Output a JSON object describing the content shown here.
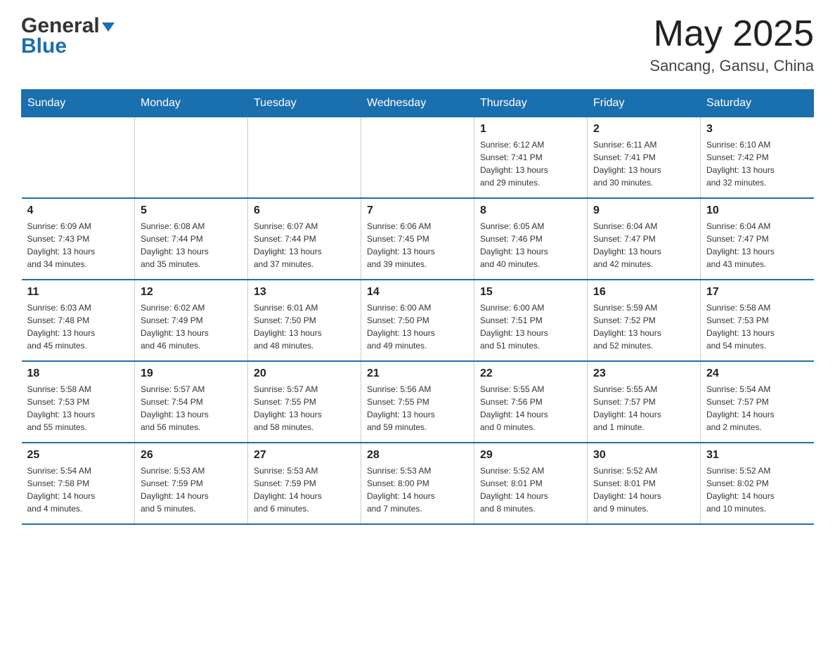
{
  "header": {
    "logo_general": "General",
    "logo_blue": "Blue",
    "month_year": "May 2025",
    "location": "Sancang, Gansu, China"
  },
  "days_of_week": [
    "Sunday",
    "Monday",
    "Tuesday",
    "Wednesday",
    "Thursday",
    "Friday",
    "Saturday"
  ],
  "weeks": [
    [
      {
        "day": "",
        "info": ""
      },
      {
        "day": "",
        "info": ""
      },
      {
        "day": "",
        "info": ""
      },
      {
        "day": "",
        "info": ""
      },
      {
        "day": "1",
        "info": "Sunrise: 6:12 AM\nSunset: 7:41 PM\nDaylight: 13 hours\nand 29 minutes."
      },
      {
        "day": "2",
        "info": "Sunrise: 6:11 AM\nSunset: 7:41 PM\nDaylight: 13 hours\nand 30 minutes."
      },
      {
        "day": "3",
        "info": "Sunrise: 6:10 AM\nSunset: 7:42 PM\nDaylight: 13 hours\nand 32 minutes."
      }
    ],
    [
      {
        "day": "4",
        "info": "Sunrise: 6:09 AM\nSunset: 7:43 PM\nDaylight: 13 hours\nand 34 minutes."
      },
      {
        "day": "5",
        "info": "Sunrise: 6:08 AM\nSunset: 7:44 PM\nDaylight: 13 hours\nand 35 minutes."
      },
      {
        "day": "6",
        "info": "Sunrise: 6:07 AM\nSunset: 7:44 PM\nDaylight: 13 hours\nand 37 minutes."
      },
      {
        "day": "7",
        "info": "Sunrise: 6:06 AM\nSunset: 7:45 PM\nDaylight: 13 hours\nand 39 minutes."
      },
      {
        "day": "8",
        "info": "Sunrise: 6:05 AM\nSunset: 7:46 PM\nDaylight: 13 hours\nand 40 minutes."
      },
      {
        "day": "9",
        "info": "Sunrise: 6:04 AM\nSunset: 7:47 PM\nDaylight: 13 hours\nand 42 minutes."
      },
      {
        "day": "10",
        "info": "Sunrise: 6:04 AM\nSunset: 7:47 PM\nDaylight: 13 hours\nand 43 minutes."
      }
    ],
    [
      {
        "day": "11",
        "info": "Sunrise: 6:03 AM\nSunset: 7:48 PM\nDaylight: 13 hours\nand 45 minutes."
      },
      {
        "day": "12",
        "info": "Sunrise: 6:02 AM\nSunset: 7:49 PM\nDaylight: 13 hours\nand 46 minutes."
      },
      {
        "day": "13",
        "info": "Sunrise: 6:01 AM\nSunset: 7:50 PM\nDaylight: 13 hours\nand 48 minutes."
      },
      {
        "day": "14",
        "info": "Sunrise: 6:00 AM\nSunset: 7:50 PM\nDaylight: 13 hours\nand 49 minutes."
      },
      {
        "day": "15",
        "info": "Sunrise: 6:00 AM\nSunset: 7:51 PM\nDaylight: 13 hours\nand 51 minutes."
      },
      {
        "day": "16",
        "info": "Sunrise: 5:59 AM\nSunset: 7:52 PM\nDaylight: 13 hours\nand 52 minutes."
      },
      {
        "day": "17",
        "info": "Sunrise: 5:58 AM\nSunset: 7:53 PM\nDaylight: 13 hours\nand 54 minutes."
      }
    ],
    [
      {
        "day": "18",
        "info": "Sunrise: 5:58 AM\nSunset: 7:53 PM\nDaylight: 13 hours\nand 55 minutes."
      },
      {
        "day": "19",
        "info": "Sunrise: 5:57 AM\nSunset: 7:54 PM\nDaylight: 13 hours\nand 56 minutes."
      },
      {
        "day": "20",
        "info": "Sunrise: 5:57 AM\nSunset: 7:55 PM\nDaylight: 13 hours\nand 58 minutes."
      },
      {
        "day": "21",
        "info": "Sunrise: 5:56 AM\nSunset: 7:55 PM\nDaylight: 13 hours\nand 59 minutes."
      },
      {
        "day": "22",
        "info": "Sunrise: 5:55 AM\nSunset: 7:56 PM\nDaylight: 14 hours\nand 0 minutes."
      },
      {
        "day": "23",
        "info": "Sunrise: 5:55 AM\nSunset: 7:57 PM\nDaylight: 14 hours\nand 1 minute."
      },
      {
        "day": "24",
        "info": "Sunrise: 5:54 AM\nSunset: 7:57 PM\nDaylight: 14 hours\nand 2 minutes."
      }
    ],
    [
      {
        "day": "25",
        "info": "Sunrise: 5:54 AM\nSunset: 7:58 PM\nDaylight: 14 hours\nand 4 minutes."
      },
      {
        "day": "26",
        "info": "Sunrise: 5:53 AM\nSunset: 7:59 PM\nDaylight: 14 hours\nand 5 minutes."
      },
      {
        "day": "27",
        "info": "Sunrise: 5:53 AM\nSunset: 7:59 PM\nDaylight: 14 hours\nand 6 minutes."
      },
      {
        "day": "28",
        "info": "Sunrise: 5:53 AM\nSunset: 8:00 PM\nDaylight: 14 hours\nand 7 minutes."
      },
      {
        "day": "29",
        "info": "Sunrise: 5:52 AM\nSunset: 8:01 PM\nDaylight: 14 hours\nand 8 minutes."
      },
      {
        "day": "30",
        "info": "Sunrise: 5:52 AM\nSunset: 8:01 PM\nDaylight: 14 hours\nand 9 minutes."
      },
      {
        "day": "31",
        "info": "Sunrise: 5:52 AM\nSunset: 8:02 PM\nDaylight: 14 hours\nand 10 minutes."
      }
    ]
  ]
}
